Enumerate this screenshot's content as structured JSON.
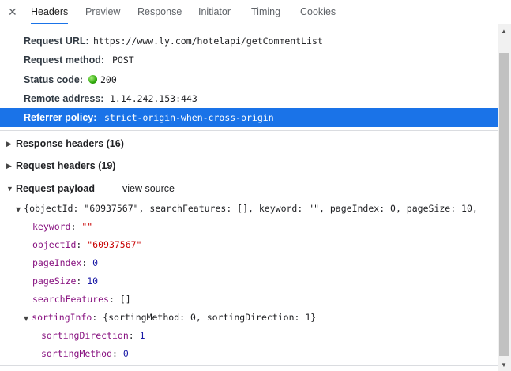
{
  "tabs": {
    "close": "✕",
    "headers": "Headers",
    "preview": "Preview",
    "response": "Response",
    "initiator": "Initiator",
    "timing": "Timing",
    "cookies": "Cookies"
  },
  "general": {
    "request_url_label": "Request URL:",
    "request_url": "https://www.ly.com/hotelapi/getCommentList",
    "request_method_label": "Request method:",
    "request_method": "POST",
    "status_code_label": "Status code:",
    "status_code": "200",
    "status_color": "#2fa80b",
    "remote_address_label": "Remote address:",
    "remote_address": "1.14.242.153:443",
    "referrer_policy_label": "Referrer policy:",
    "referrer_policy": "strict-origin-when-cross-origin"
  },
  "sections": {
    "response_headers": "Response headers (16)",
    "request_headers": "Request headers (19)",
    "request_payload": "Request payload",
    "view_source": "view source"
  },
  "payload": {
    "summary": "{objectId: \"60937567\", searchFeatures: [], keyword: \"\", pageIndex: 0, pageSize: 10,",
    "keyword_key": "keyword",
    "keyword_val": "\"\"",
    "objectId_key": "objectId",
    "objectId_val": "\"60937567\"",
    "pageIndex_key": "pageIndex",
    "pageIndex_val": "0",
    "pageSize_key": "pageSize",
    "pageSize_val": "10",
    "searchFeatures_key": "searchFeatures",
    "searchFeatures_val": "[]",
    "sortingInfo_key": "sortingInfo",
    "sortingInfo_summary": "{sortingMethod: 0, sortingDirection: 1}",
    "sortingDirection_key": "sortingDirection",
    "sortingDirection_val": "1",
    "sortingMethod_key": "sortingMethod",
    "sortingMethod_val": "0"
  },
  "colors": {
    "accent": "#1a73e8",
    "key": "#881280",
    "string": "#c80000",
    "number": "#1a1aa6"
  }
}
